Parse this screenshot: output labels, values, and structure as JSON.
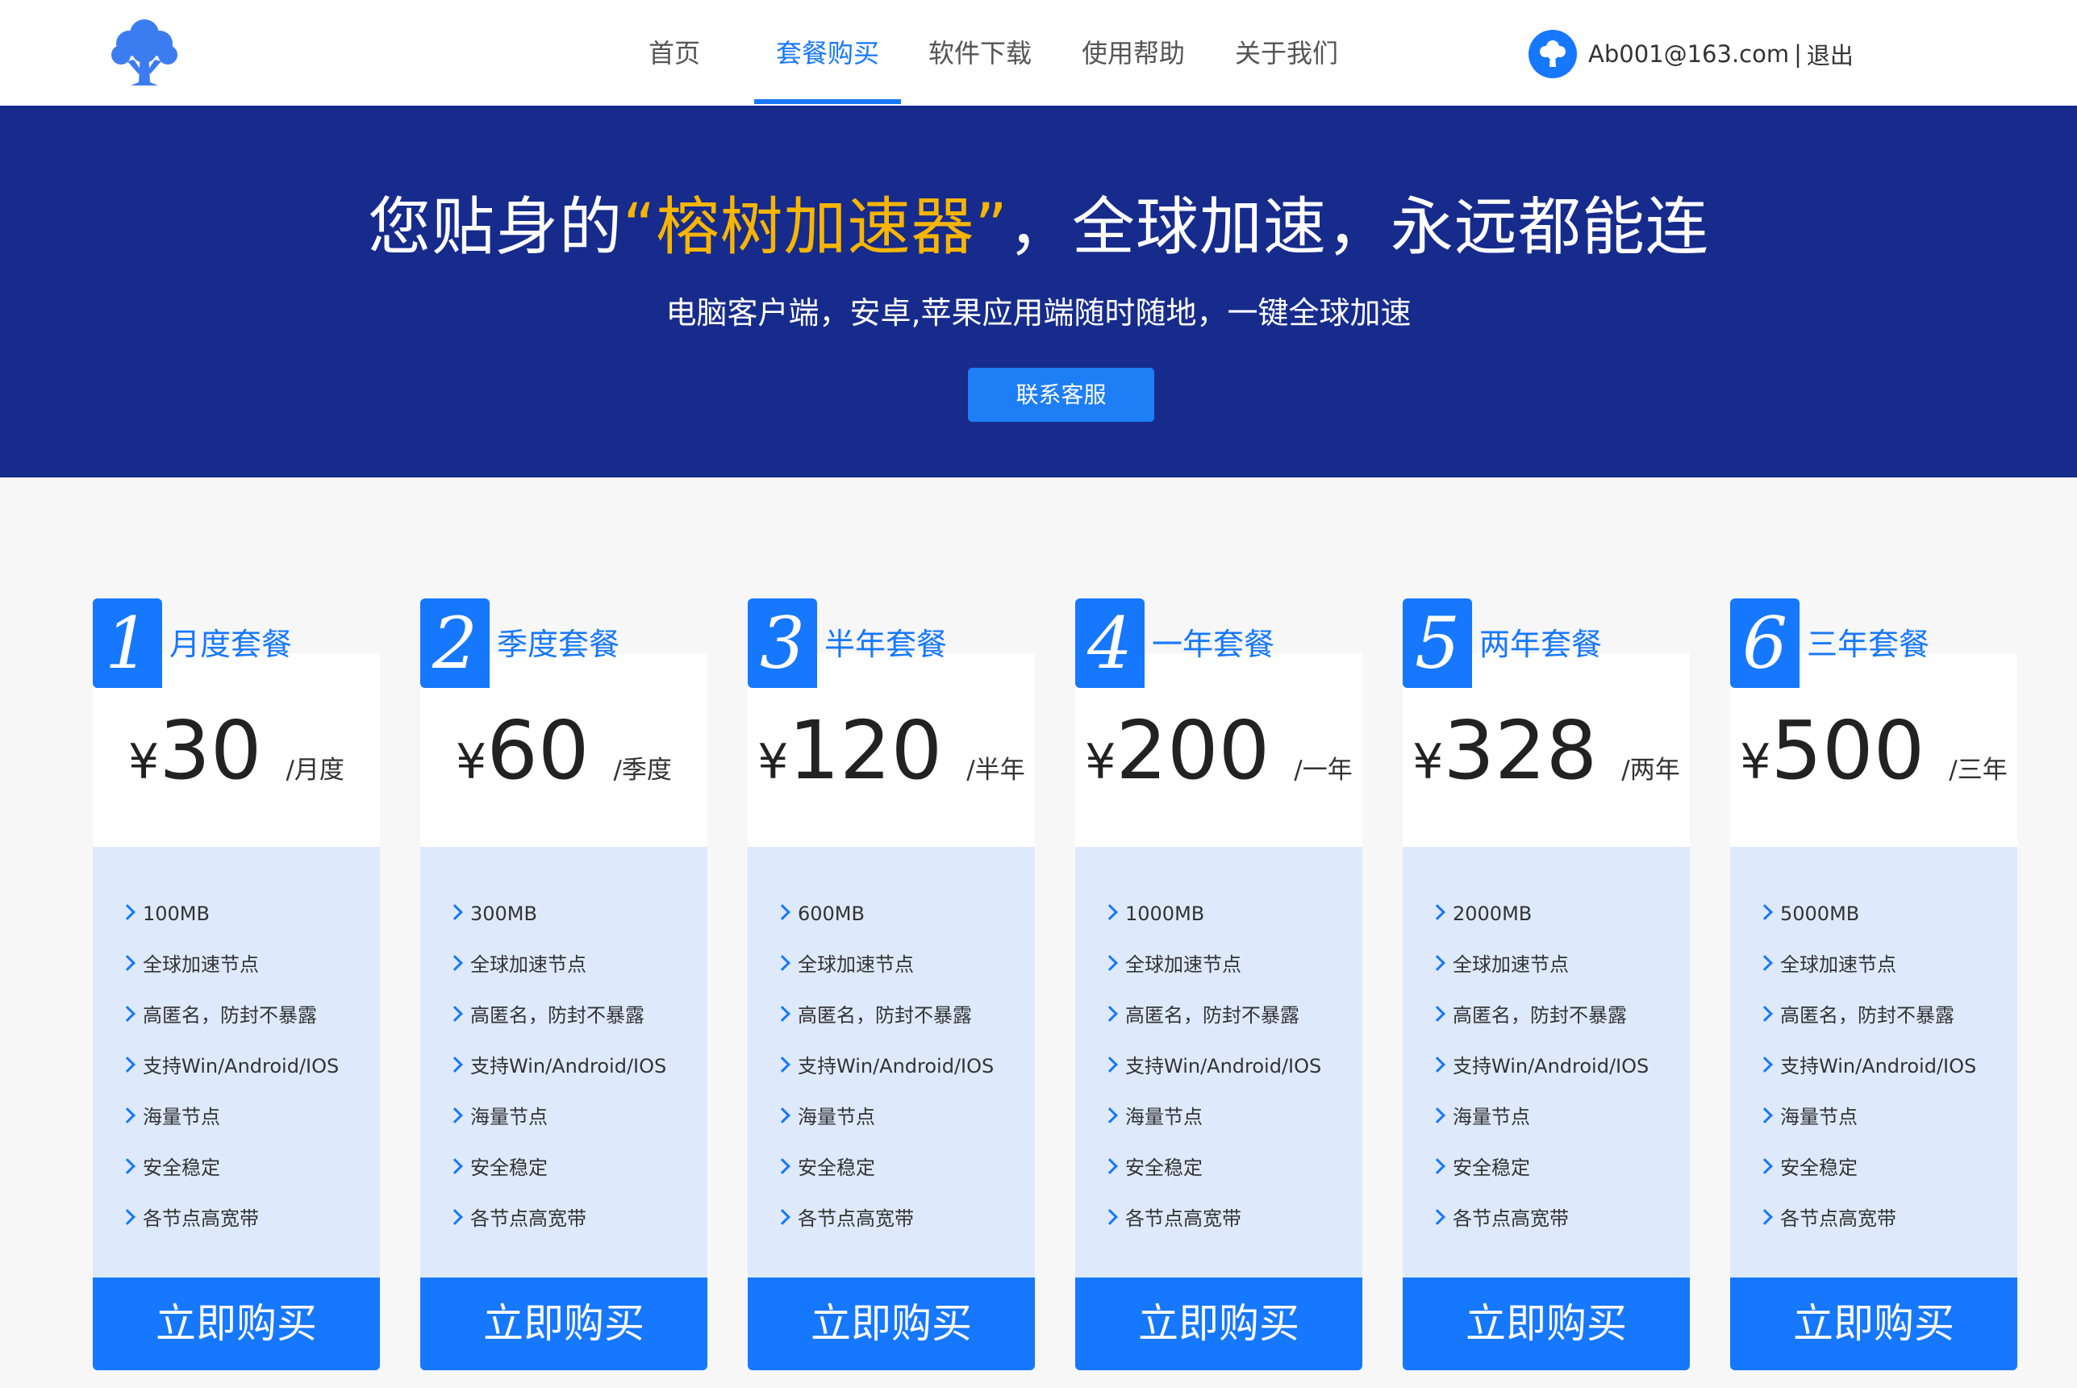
{
  "nav": {
    "items": [
      {
        "label": "首页",
        "active": false
      },
      {
        "label": "套餐购买",
        "active": true
      },
      {
        "label": "软件下载",
        "active": false
      },
      {
        "label": "使用帮助",
        "active": false
      },
      {
        "label": "关于我们",
        "active": false
      }
    ]
  },
  "user": {
    "email": "Ab001@163.com",
    "separator": "|",
    "logout": "退出"
  },
  "hero": {
    "title_pre": "您贴身的",
    "title_brand": "“榕树加速器”",
    "title_post": "，全球加速，永远都能连",
    "subtitle": "电脑客户端，安卓,苹果应用端随时随地，一键全球加速",
    "button": "联系客服"
  },
  "colors": {
    "accent": "#1677ff",
    "hero_bg": "#172b8c",
    "brand_highlight": "#f7b500",
    "feature_bg": "#deeafc"
  },
  "currency": "¥",
  "buy_label": "立即购买",
  "plans": [
    {
      "num": "1",
      "name": "月度套餐",
      "price": "30",
      "unit": "/月度",
      "features": [
        "100MB",
        "全球加速节点",
        "高匿名，防封不暴露",
        "支持Win/Android/IOS",
        "海量节点",
        "安全稳定",
        "各节点高宽带"
      ]
    },
    {
      "num": "2",
      "name": "季度套餐",
      "price": "60",
      "unit": "/季度",
      "features": [
        "300MB",
        "全球加速节点",
        "高匿名，防封不暴露",
        "支持Win/Android/IOS",
        "海量节点",
        "安全稳定",
        "各节点高宽带"
      ]
    },
    {
      "num": "3",
      "name": "半年套餐",
      "price": "120",
      "unit": "/半年",
      "features": [
        "600MB",
        "全球加速节点",
        "高匿名，防封不暴露",
        "支持Win/Android/IOS",
        "海量节点",
        "安全稳定",
        "各节点高宽带"
      ]
    },
    {
      "num": "4",
      "name": "一年套餐",
      "price": "200",
      "unit": "/一年",
      "features": [
        "1000MB",
        "全球加速节点",
        "高匿名，防封不暴露",
        "支持Win/Android/IOS",
        "海量节点",
        "安全稳定",
        "各节点高宽带"
      ]
    },
    {
      "num": "5",
      "name": "两年套餐",
      "price": "328",
      "unit": "/两年",
      "features": [
        "2000MB",
        "全球加速节点",
        "高匿名，防封不暴露",
        "支持Win/Android/IOS",
        "海量节点",
        "安全稳定",
        "各节点高宽带"
      ]
    },
    {
      "num": "6",
      "name": "三年套餐",
      "price": "500",
      "unit": "/三年",
      "features": [
        "5000MB",
        "全球加速节点",
        "高匿名，防封不暴露",
        "支持Win/Android/IOS",
        "海量节点",
        "安全稳定",
        "各节点高宽带"
      ]
    }
  ]
}
